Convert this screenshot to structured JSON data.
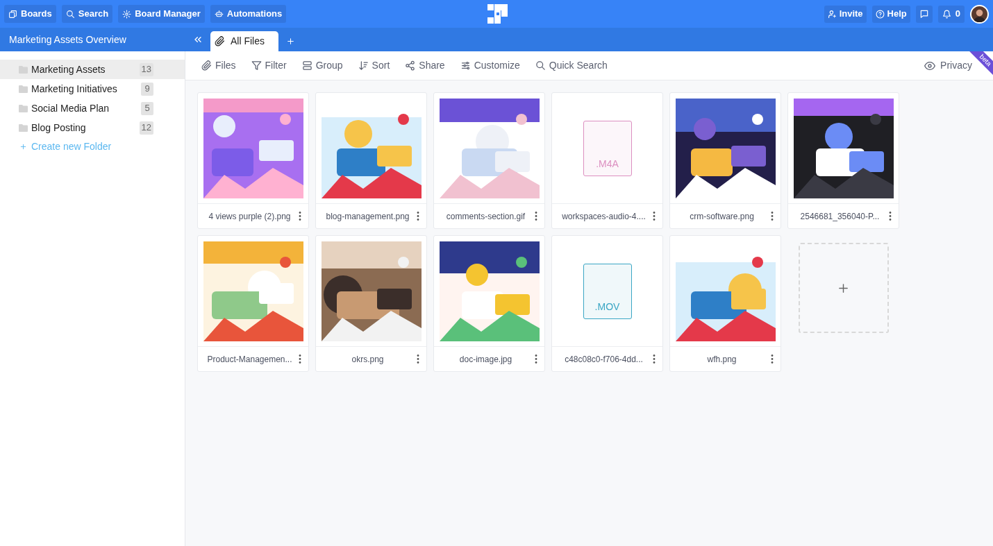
{
  "top_nav": {
    "left_buttons": [
      {
        "label": "Boards"
      },
      {
        "label": "Search"
      },
      {
        "label": "Board Manager"
      },
      {
        "label": "Automations"
      }
    ],
    "right_buttons": [
      {
        "label": "Invite"
      },
      {
        "label": "Help"
      }
    ],
    "notifications": {
      "count": "0"
    }
  },
  "board": {
    "title": "Marketing Assets Overview"
  },
  "tabs": [
    {
      "label": "All Files",
      "selected": true
    }
  ],
  "toolbar": {
    "items": [
      {
        "label": "Files"
      },
      {
        "label": "Filter"
      },
      {
        "label": "Group"
      },
      {
        "label": "Sort"
      },
      {
        "label": "Share"
      },
      {
        "label": "Customize"
      },
      {
        "label": "Quick Search"
      }
    ],
    "privacy": "Privacy",
    "badge": "beta"
  },
  "sidebar": {
    "folders": [
      {
        "name": "Marketing Assets",
        "count": "13",
        "selected": true
      },
      {
        "name": "Marketing Initiatives",
        "count": "9",
        "selected": false
      },
      {
        "name": "Social Media Plan",
        "count": "5",
        "selected": false
      },
      {
        "name": "Blog Posting",
        "count": "12",
        "selected": false
      }
    ],
    "create_label": "Create new Folder"
  },
  "files": [
    {
      "name": "4 views purple (2).png",
      "kind": "picture"
    },
    {
      "name": "blog-management.png",
      "kind": "picture"
    },
    {
      "name": "comments-section.gif",
      "kind": "picture"
    },
    {
      "name": "workspaces-audio-4....",
      "kind": "file",
      "extension": ".M4A",
      "color": "#dc8fc0"
    },
    {
      "name": "crm-software.png",
      "kind": "picture"
    },
    {
      "name": "2546681_356040-P...",
      "kind": "picture"
    },
    {
      "name": "Product-Managemen...",
      "kind": "picture"
    },
    {
      "name": "okrs.png",
      "kind": "picture"
    },
    {
      "name": "doc-image.jpg",
      "kind": "picture"
    },
    {
      "name": "c48c08c0-f706-4dd...",
      "kind": "file",
      "extension": ".MOV",
      "color": "#3aa6c4"
    },
    {
      "name": "wfh.png",
      "kind": "picture"
    }
  ]
}
